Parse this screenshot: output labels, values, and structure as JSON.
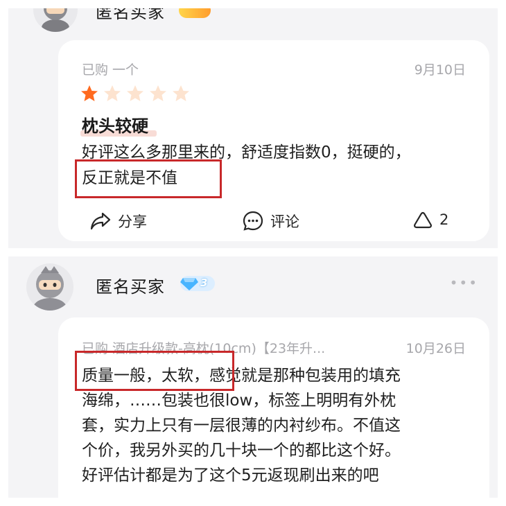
{
  "review1": {
    "username": "匿名买家",
    "meta": "已购 一个",
    "date": "9月10日",
    "rating": 1,
    "max_rating": 5,
    "title": "枕头较硬",
    "body_lines": [
      "好评这么多那里来的，舒适度指数0，挺硬的，",
      "反正就是不值"
    ],
    "actions": {
      "share": "分享",
      "comment": "评论",
      "like_count": "2"
    }
  },
  "review2": {
    "username": "匿名买家",
    "badge_level": "3",
    "meta": "已购 酒店升级款-高枕(10cm)【23年升...",
    "date": "10月26日",
    "body_lines": [
      "质量一般，太软，感觉就是那种包装用的填充",
      "海绵，……包装也很low，标签上明明有外枕",
      "套，实力上只有一层很薄的内衬纱布。不值这",
      "个价，我另外买的几十块一个的都比这个好。",
      "好评估计都是为了这个5元返现刷出来的吧"
    ],
    "more": "•••"
  },
  "colors": {
    "star_on": "#ff6a1f",
    "star_off": "#fde3cf",
    "highlight_box": "#c8282a",
    "badge": "#47b4ff"
  }
}
